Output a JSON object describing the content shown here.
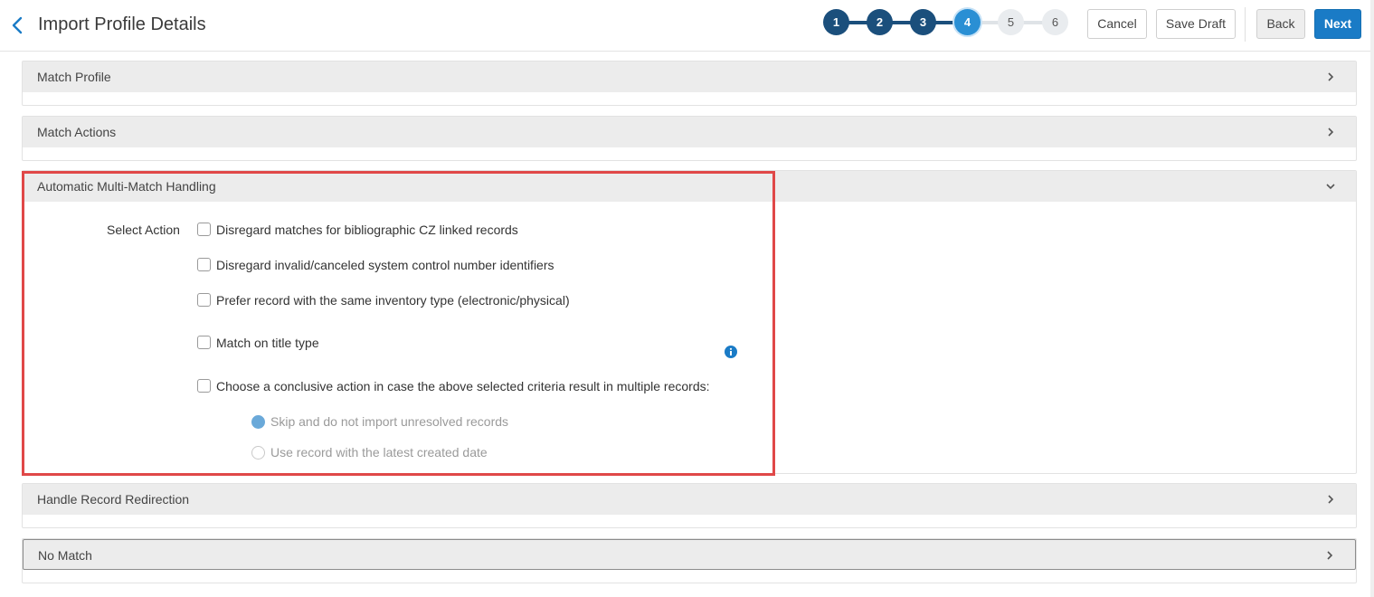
{
  "header": {
    "title": "Import Profile Details",
    "steps": [
      "1",
      "2",
      "3",
      "4",
      "5",
      "6"
    ],
    "current_step": 4,
    "buttons": {
      "cancel": "Cancel",
      "save_draft": "Save Draft",
      "back": "Back",
      "next": "Next"
    }
  },
  "panels": {
    "match_profile": "Match Profile",
    "match_actions": "Match Actions",
    "multi_match": "Automatic Multi-Match Handling",
    "redirection": "Handle Record Redirection",
    "no_match": "No Match"
  },
  "multi_match": {
    "select_action_label": "Select Action",
    "options": [
      "Disregard matches for bibliographic CZ linked records",
      "Disregard invalid/canceled system control number identifiers",
      "Prefer record with the same inventory type (electronic/physical)",
      "Match on title type",
      "Choose a conclusive action in case the above selected criteria result in multiple records:"
    ],
    "conclusive_options": [
      "Skip and do not import unresolved records",
      "Use record with the latest created date"
    ],
    "selected_conclusive": "Skip and do not import unresolved records"
  },
  "colors": {
    "step_done": "#1b4f7c",
    "step_current": "#2a8fd4",
    "step_todo": "#e9ecef",
    "primary_button": "#1a7bc6",
    "highlight_border": "#e04848"
  },
  "icons": {
    "back": "chevron-left-icon",
    "collapsed": "chevron-right-icon",
    "expanded": "chevron-down-icon",
    "info": "info-icon"
  }
}
